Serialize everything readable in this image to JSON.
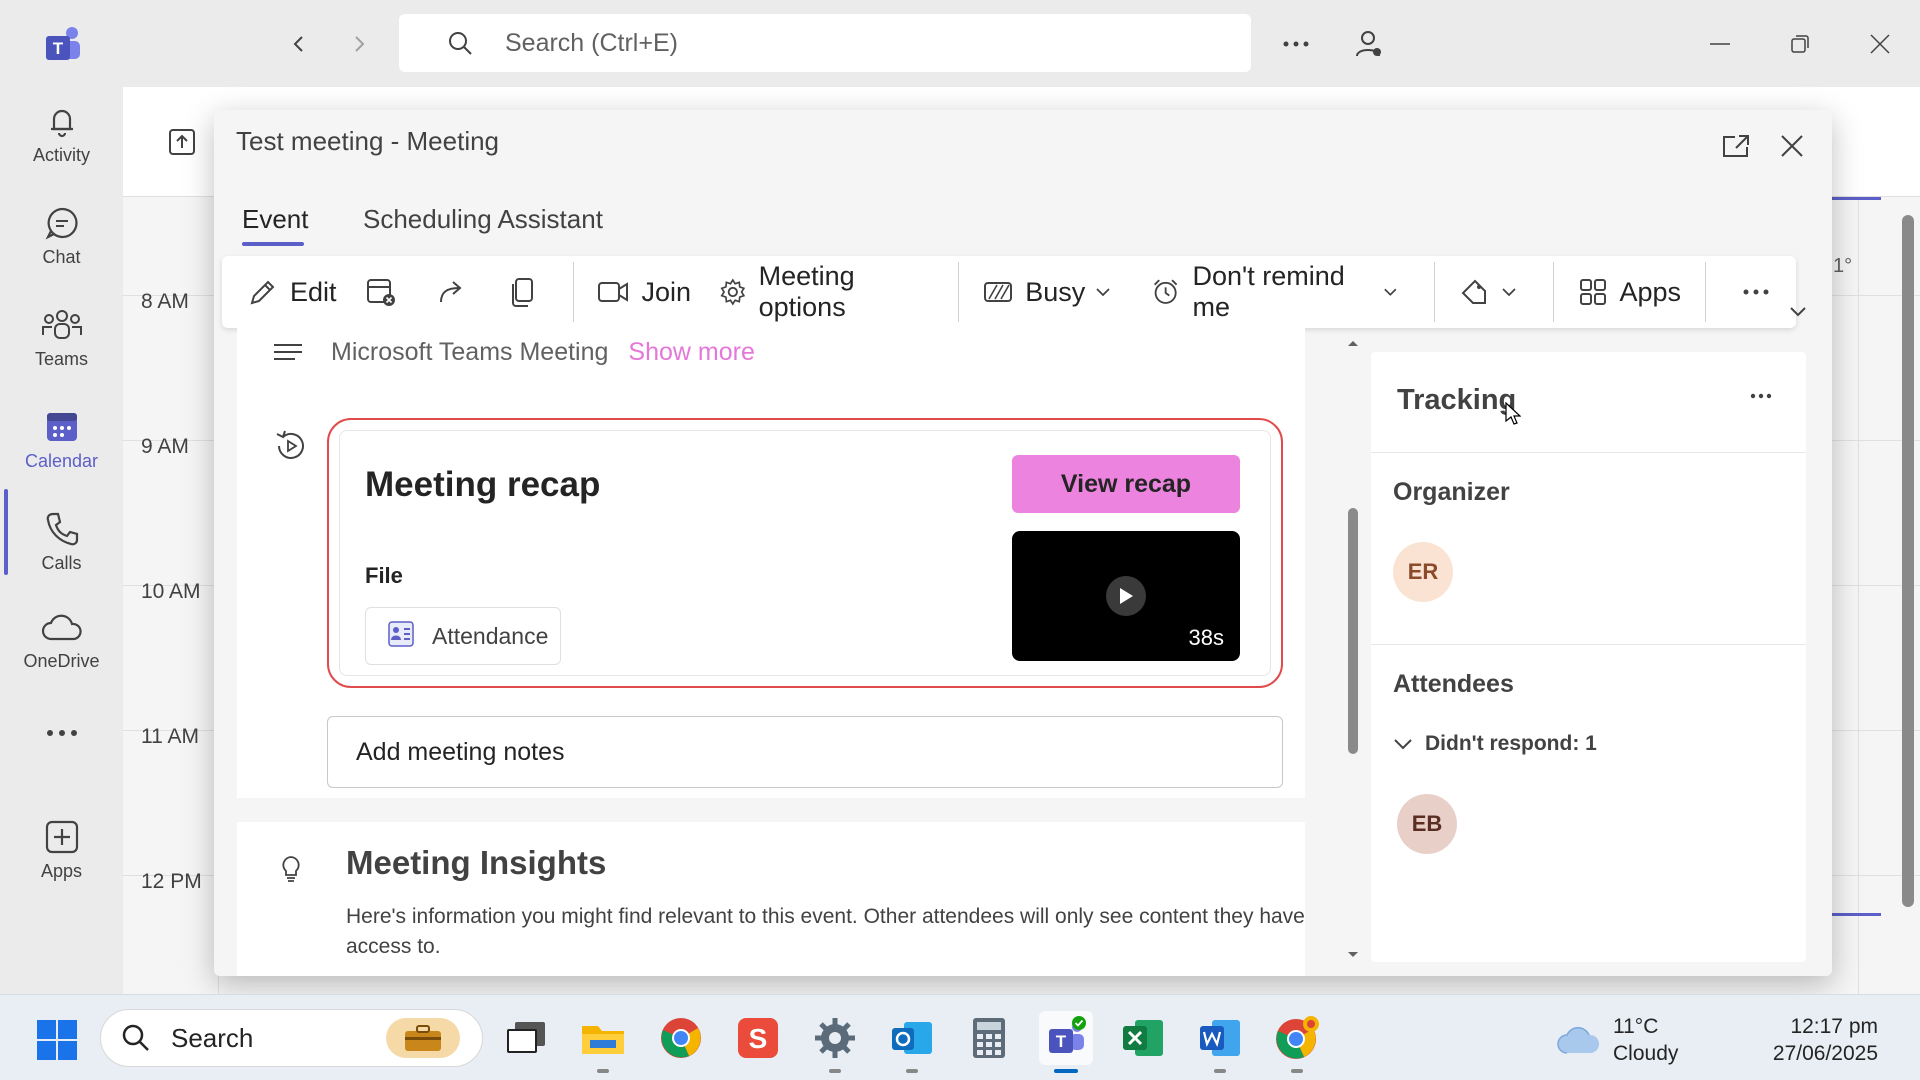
{
  "titlebar": {
    "search_placeholder": "Search (Ctrl+E)"
  },
  "rail": {
    "items": [
      {
        "label": "Activity"
      },
      {
        "label": "Chat"
      },
      {
        "label": "Teams"
      },
      {
        "label": "Calendar"
      },
      {
        "label": "Calls"
      },
      {
        "label": "OneDrive"
      },
      {
        "label": "Apps"
      }
    ]
  },
  "calendar": {
    "hours": [
      "8 AM",
      "9 AM",
      "10 AM",
      "11 AM",
      "12 PM"
    ],
    "partial_temp": "1°"
  },
  "dialog": {
    "title": "Test meeting - Meeting",
    "tabs": [
      "Event",
      "Scheduling Assistant"
    ],
    "toolbar": {
      "edit": "Edit",
      "join": "Join",
      "meeting_options": "Meeting options",
      "busy": "Busy",
      "remind": "Don't remind me",
      "apps": "Apps"
    },
    "description": {
      "text": "Microsoft Teams Meeting",
      "show_more": "Show more"
    },
    "recap": {
      "title": "Meeting recap",
      "view_button": "View recap",
      "file_label": "File",
      "attachment": "Attendance",
      "duration": "38s"
    },
    "notes": {
      "label": "Add meeting notes"
    },
    "insights": {
      "title": "Meeting Insights",
      "body": "Here's information you might find relevant to this event. Other attendees will only see content they have access to."
    },
    "tracking": {
      "title": "Tracking",
      "organizer_label": "Organizer",
      "organizer_initials": "ER",
      "attendees_label": "Attendees",
      "didnt_respond": "Didn't respond: 1",
      "attendee_initials": "EB"
    }
  },
  "taskbar": {
    "search": "Search",
    "weather_temp": "11°C",
    "weather_desc": "Cloudy",
    "time": "12:17 pm",
    "date": "27/06/2025"
  },
  "colors": {
    "accent": "#5b5fc7",
    "recap_button": "#ec84df",
    "highlight_border": "#e24b4b",
    "show_more": "#e577d9"
  }
}
